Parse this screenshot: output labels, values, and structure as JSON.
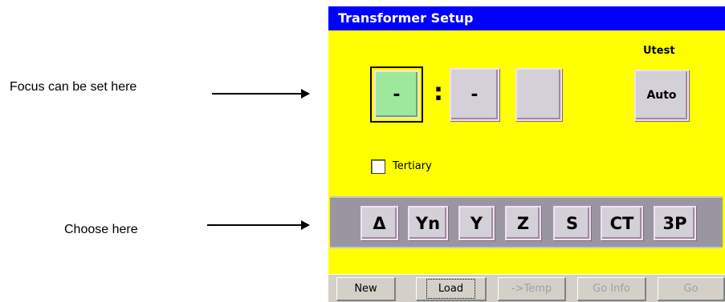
{
  "annotations": {
    "focus_text": "Focus can be set here",
    "choose_text": "Choose here"
  },
  "window": {
    "title": "Transformer Setup",
    "colors": {
      "title_bg": "#0000ff",
      "panel_bg": "#ffff00",
      "focused_field": "#9ee89e",
      "chooser_bg": "#9a96a0"
    }
  },
  "vector_group": {
    "fields": [
      {
        "value": "-",
        "focused": true
      },
      {
        "value": "-",
        "focused": false
      },
      {
        "value": "",
        "focused": false
      }
    ],
    "separator": ":"
  },
  "utest": {
    "label": "Utest",
    "button_label": "Auto"
  },
  "tertiary": {
    "label": "Tertiary",
    "checked": false
  },
  "chooser": {
    "buttons": [
      "Δ",
      "Yn",
      "Y",
      "Z",
      "S",
      "CT",
      "3P"
    ]
  },
  "bottom_bar": {
    "buttons": [
      {
        "label": "New",
        "enabled": true
      },
      {
        "label": "Load",
        "enabled": true
      },
      {
        "label": "->Temp",
        "enabled": false
      },
      {
        "label": "Go Info",
        "enabled": false
      },
      {
        "label": "Go",
        "enabled": false
      }
    ]
  }
}
